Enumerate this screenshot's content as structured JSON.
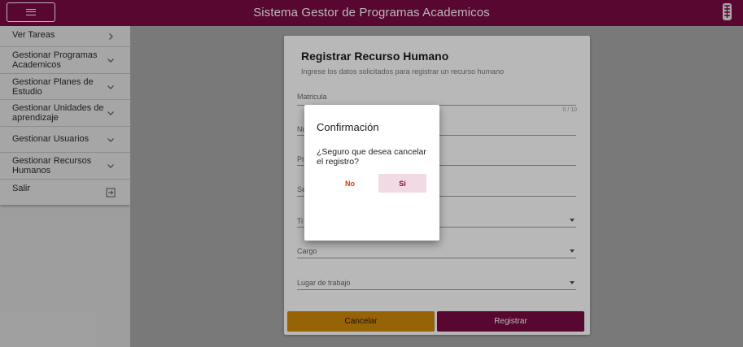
{
  "header": {
    "title": "Sistema Gestor de Programas Academicos",
    "menu_icon": "hamburger-icon",
    "logo_icon": "institution-logo-icon"
  },
  "sidebar": {
    "items": [
      {
        "label": "Ver Tareas",
        "icon": "chevron-right-icon"
      },
      {
        "label": "Gestionar Programas Academicos",
        "icon": "chevron-down-icon"
      },
      {
        "label": "Gestionar Planes de Estudio",
        "icon": "chevron-down-icon"
      },
      {
        "label": "Gestionar Unidades de aprendizaje",
        "icon": "chevron-down-icon"
      },
      {
        "label": "Gestionar Usuarios",
        "icon": "chevron-down-icon"
      },
      {
        "label": "Gestionar Recursos Humanos",
        "icon": "chevron-down-icon"
      },
      {
        "label": "Salir",
        "icon": "exit-icon"
      }
    ]
  },
  "form": {
    "title": "Registrar Recurso Humano",
    "subtitle": "Ingrese los datos solicitados para registrar un recurso humano",
    "fields": [
      {
        "label": "Matricula",
        "counter": "0 / 10"
      },
      {
        "label": "No"
      },
      {
        "label": "Pr"
      },
      {
        "label": "Se"
      },
      {
        "label": "Ti"
      },
      {
        "label": "Cargo"
      },
      {
        "label": "Lugar de trabajo"
      }
    ],
    "cancel_label": "Cancelar",
    "submit_label": "Registrar"
  },
  "dialog": {
    "title": "Confirmación",
    "message": "¿Seguro que desea cancelar el registro?",
    "no_label": "No",
    "yes_label": "Si"
  },
  "colors": {
    "brand": "#7a0a45",
    "cancel": "#d08a0a",
    "no_text": "#d23d05",
    "yes_bg": "#f2dae5"
  }
}
